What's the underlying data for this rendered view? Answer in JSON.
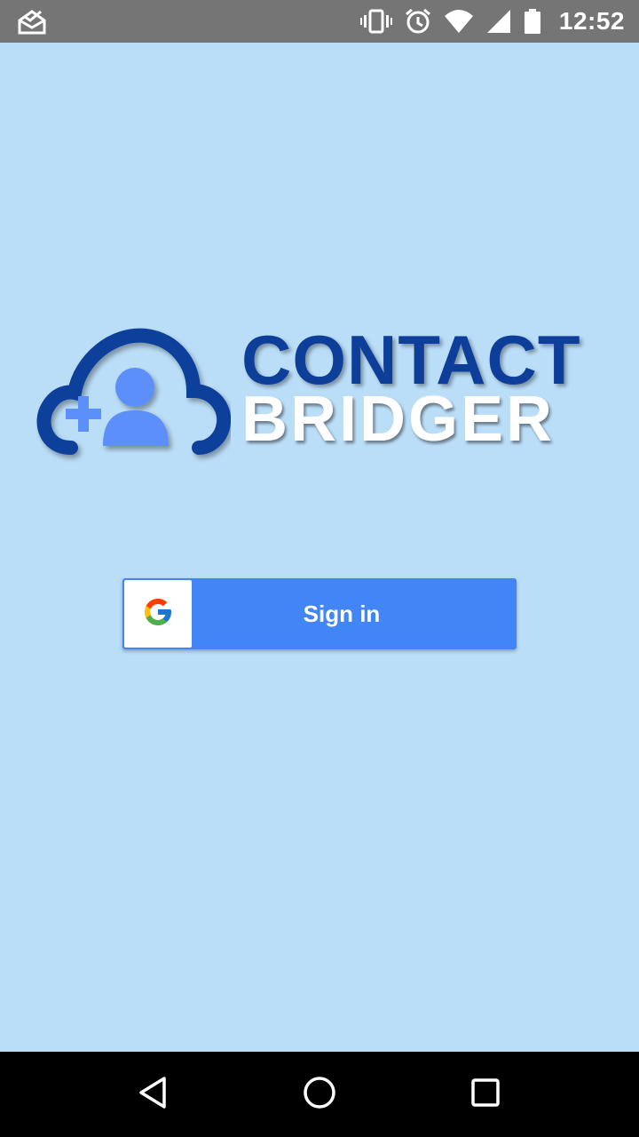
{
  "status_bar": {
    "time": "12:52",
    "icons": [
      "notification-mail-icon",
      "vibrate-icon",
      "alarm-icon",
      "wifi-icon",
      "signal-icon",
      "battery-icon"
    ],
    "background": "#757575"
  },
  "app": {
    "background": "#bbdef8",
    "logo": {
      "line1": "CONTACT",
      "line2": "BRIDGER",
      "line1_color": "#0d3f9a",
      "line2_color": "#ffffff",
      "cloud_color": "#0d3f9a",
      "person_color": "#5b8ff9"
    },
    "signin": {
      "label": "Sign in",
      "color": "#4285f4",
      "icon": "google-icon"
    }
  },
  "nav_bar": {
    "buttons": [
      "back-icon",
      "home-icon",
      "recents-icon"
    ]
  }
}
